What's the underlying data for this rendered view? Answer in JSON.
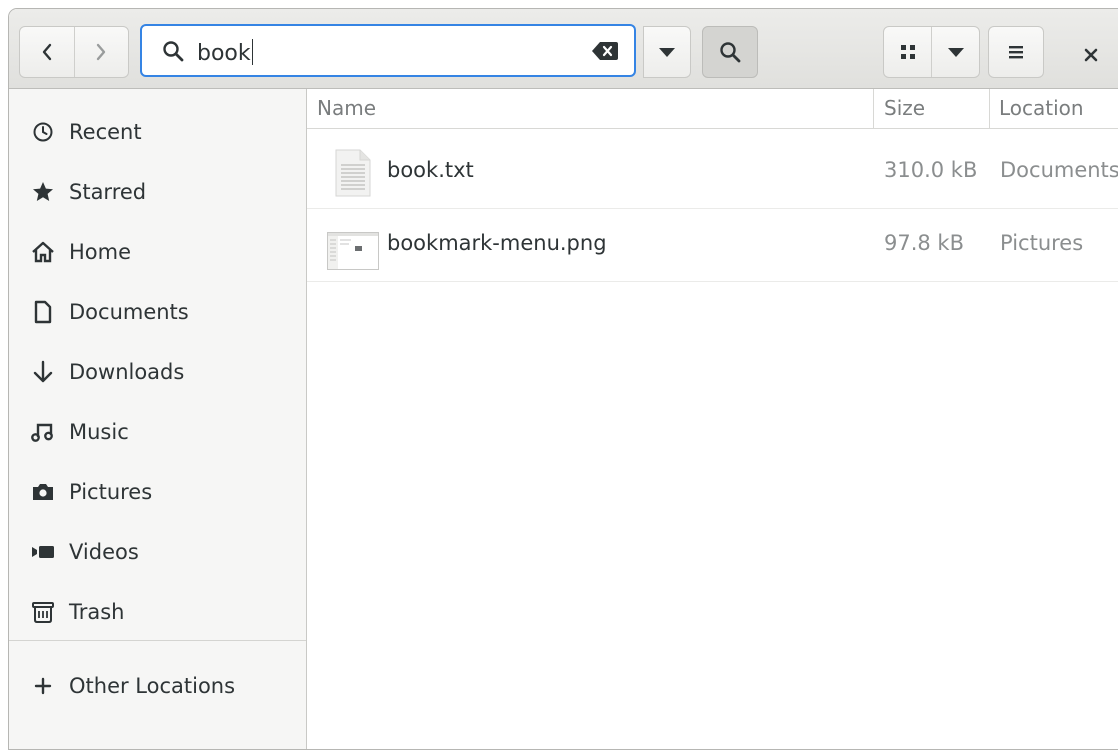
{
  "search": {
    "query": "book"
  },
  "sidebar": {
    "items": [
      {
        "label": "Recent",
        "icon": "clock-icon"
      },
      {
        "label": "Starred",
        "icon": "star-icon"
      },
      {
        "label": "Home",
        "icon": "home-icon"
      },
      {
        "label": "Documents",
        "icon": "document-icon"
      },
      {
        "label": "Downloads",
        "icon": "download-arrow-icon"
      },
      {
        "label": "Music",
        "icon": "music-note-icon"
      },
      {
        "label": "Pictures",
        "icon": "camera-icon"
      },
      {
        "label": "Videos",
        "icon": "video-camera-icon"
      },
      {
        "label": "Trash",
        "icon": "trash-icon"
      }
    ],
    "other_locations": {
      "label": "Other Locations",
      "icon": "plus-icon"
    }
  },
  "columns": {
    "name": "Name",
    "size": "Size",
    "location": "Location"
  },
  "files": [
    {
      "name": "book.txt",
      "size": "310.0 kB",
      "location": "Documents",
      "icon": "text-file-icon"
    },
    {
      "name": "bookmark-menu.png",
      "size": "97.8 kB",
      "location": "Pictures",
      "icon": "image-thumbnail-icon"
    }
  ],
  "colors": {
    "accent": "#3584e4",
    "headerbar": "#e6e6e3",
    "sidebar": "#f6f6f5"
  }
}
